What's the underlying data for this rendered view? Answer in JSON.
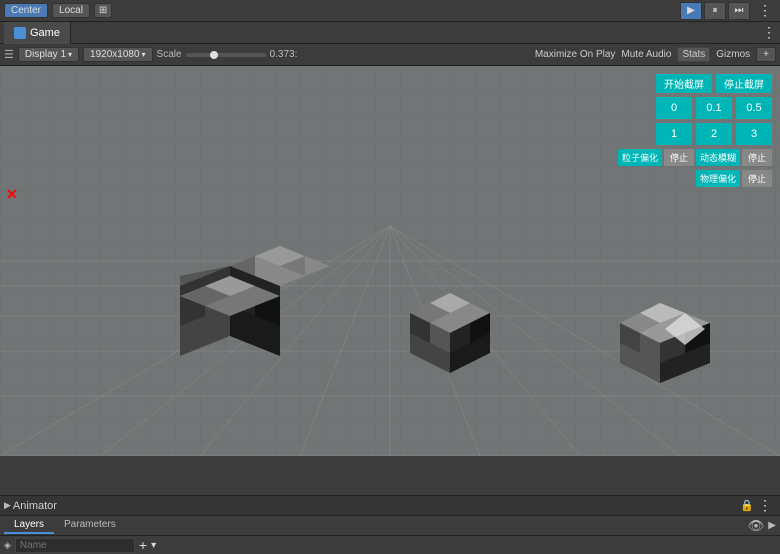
{
  "toolbar": {
    "center_label": "Center",
    "local_label": "Local",
    "dots_label": "⋮",
    "play_icon": "▶",
    "pause_icon": "⏸",
    "step_icon": "⏭"
  },
  "game_tab": {
    "icon": "🎮",
    "label": "Game",
    "add": "+",
    "dots": "⋮"
  },
  "options_bar": {
    "display_label": "Display 1",
    "resolution_label": "1920x1080",
    "scale_label": "Scale",
    "scale_value": "0.373:",
    "maximize_label": "Maximize On Play",
    "mute_label": "Mute Audio",
    "stats_label": "Stats",
    "gizmos_label": "Gizmos",
    "add_icon": "+"
  },
  "game_overlay": {
    "start_capture": "开始截屏",
    "stop_capture": "停止截屏",
    "num0": "0",
    "num01": "0.1",
    "num05": "0.5",
    "num1": "1",
    "num2": "2",
    "num3": "3",
    "particle_sim": "粒子偏化",
    "stop1": "停止",
    "motion_blur": "动态模糊",
    "stop2": "停止",
    "batch_sim": "物理偏化",
    "stop3": "停止"
  },
  "animator_panel": {
    "title": "Animator",
    "title_icon": "🔧",
    "lock_icon": "🔒",
    "dots": "⋮",
    "tabs": {
      "layers_label": "Layers",
      "parameters_label": "Parameters"
    },
    "name_field": {
      "icon": "◈",
      "placeholder": "Name",
      "add": "+",
      "arrow": "▾"
    }
  },
  "colors": {
    "teal": "#00b5b5",
    "accent_blue": "#4a90d9",
    "toolbar_bg": "#3c3c3c",
    "viewport_bg": "#7a8080",
    "grid_line": "rgba(90,90,90,0.6)"
  }
}
